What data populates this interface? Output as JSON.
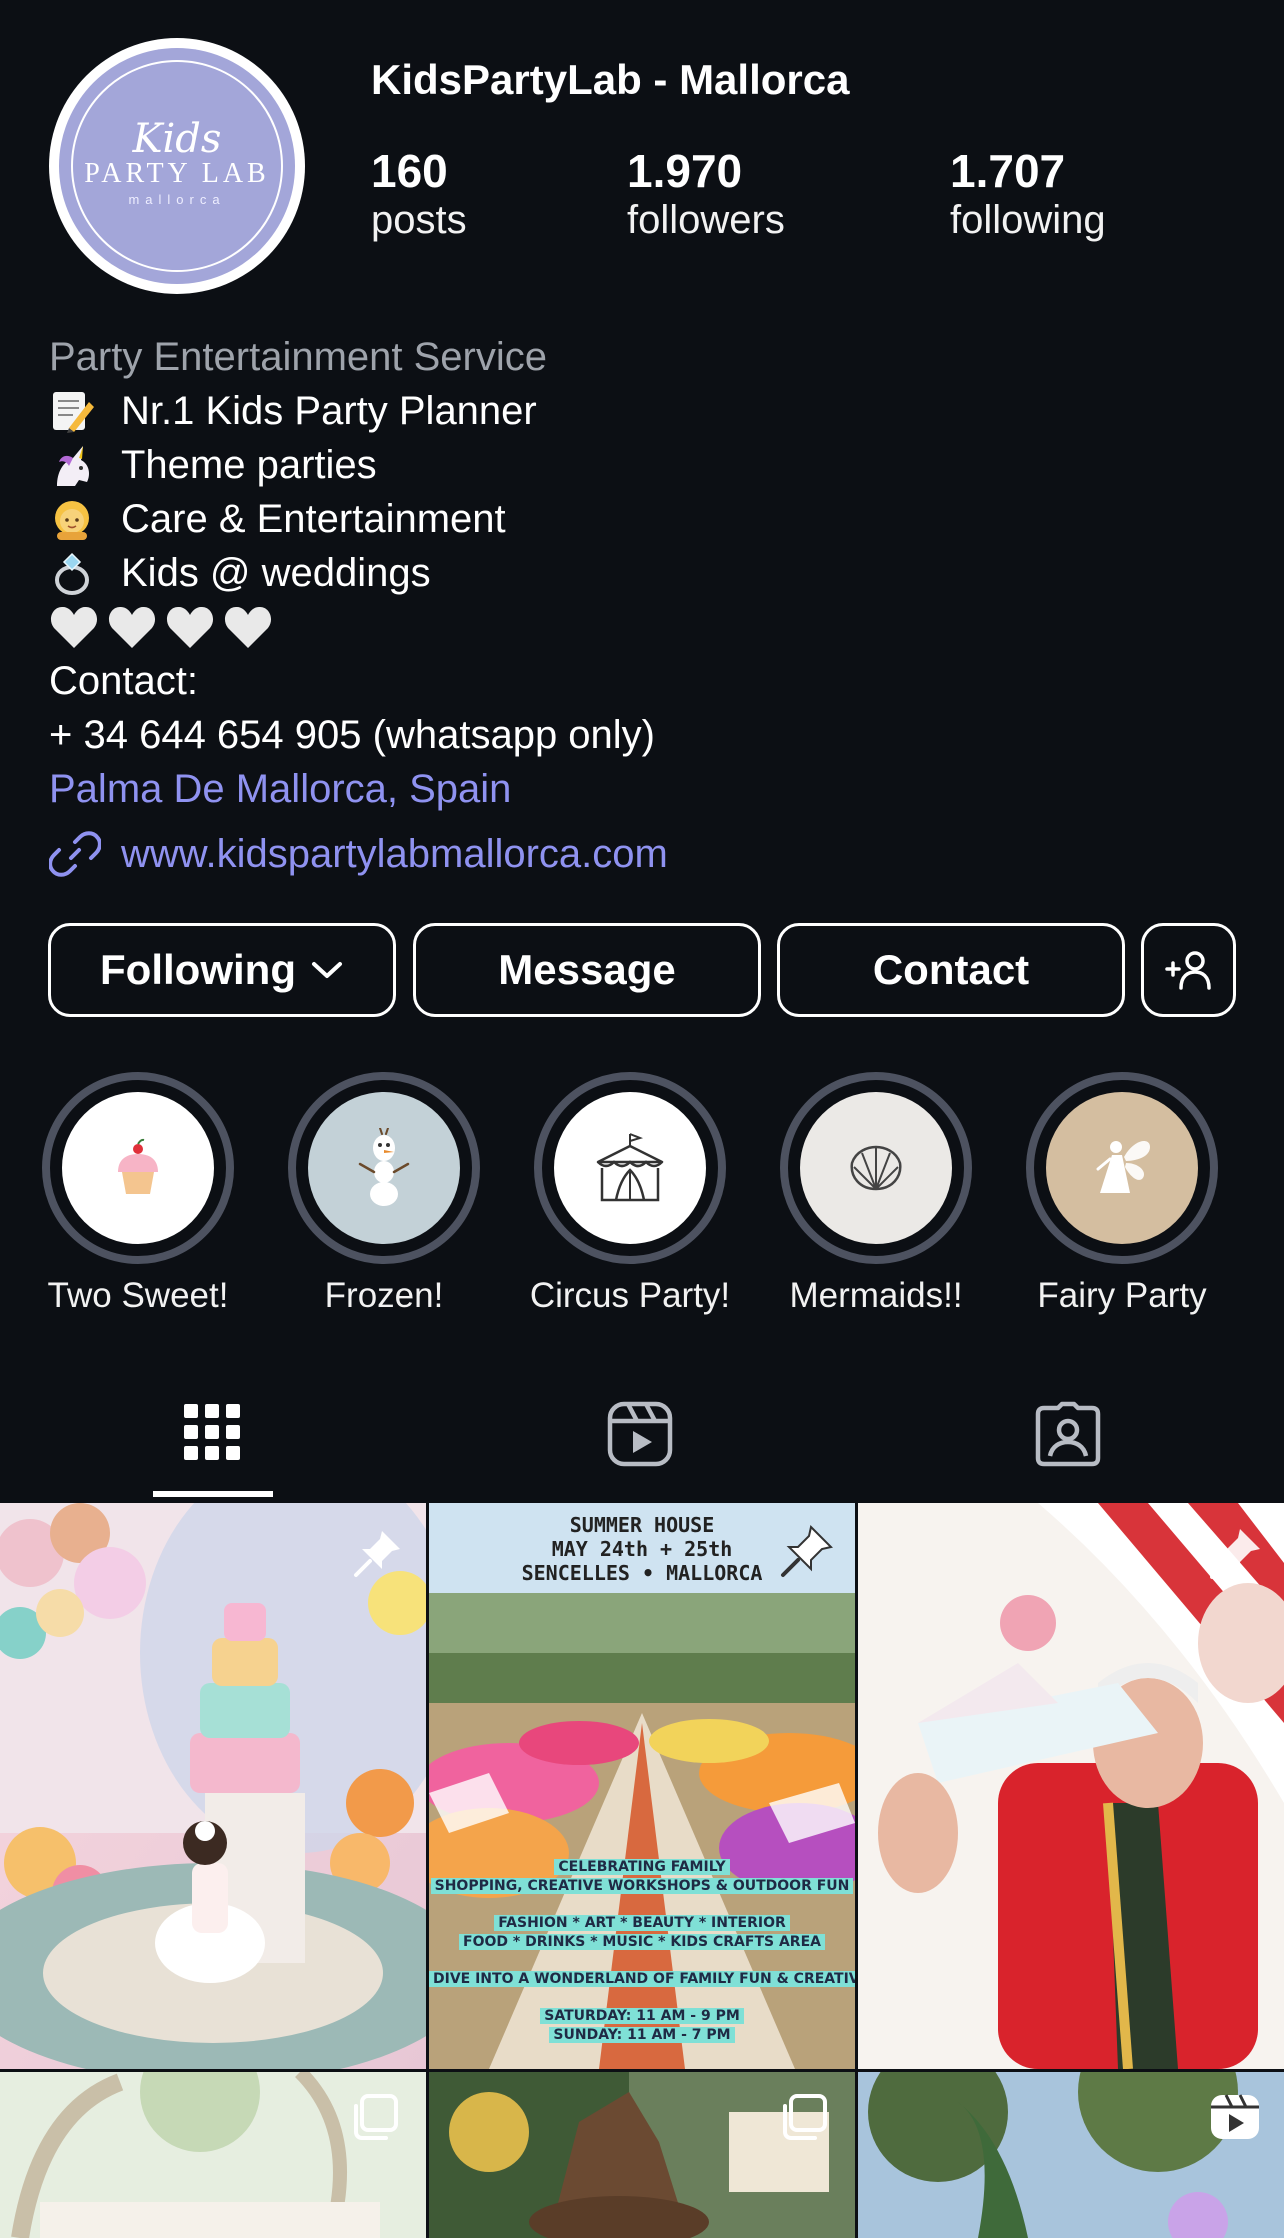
{
  "profile": {
    "username": "KidsPartyLab - Mallorca",
    "avatar": {
      "script": "Kids",
      "main": "PARTY LAB",
      "sub": "mallorca"
    },
    "stats": [
      {
        "value": "160",
        "label": "posts"
      },
      {
        "value": "1.970",
        "label": "followers"
      },
      {
        "value": "1.707",
        "label": "following"
      }
    ]
  },
  "bio": {
    "category": "Party Entertainment Service",
    "lines": [
      {
        "icon": "memo-emoji",
        "text": "Nr.1 Kids Party Planner"
      },
      {
        "icon": "unicorn-emoji",
        "text": "Theme parties"
      },
      {
        "icon": "girl-emoji",
        "text": "Care & Entertainment"
      },
      {
        "icon": "ring-emoji",
        "text": "Kids @ weddings"
      }
    ],
    "hearts": "🤍🤍🤍🤍",
    "contact_label": "Contact:",
    "phone": "+ 34 644 654 905 (whatsapp only)",
    "location": "Palma De Mallorca, Spain",
    "website": "www.kidspartylabmallorca.com"
  },
  "actions": {
    "following": "Following",
    "message": "Message",
    "contact": "Contact"
  },
  "highlights": [
    {
      "label": "Two Sweet!",
      "icon": "cupcake-icon",
      "bg": "#ffffff"
    },
    {
      "label": "Frozen!",
      "icon": "snowman-icon",
      "bg": "#c3d1d7"
    },
    {
      "label": "Circus Party!",
      "icon": "circus-tent-icon",
      "bg": "#ffffff"
    },
    {
      "label": "Mermaids!!",
      "icon": "shell-icon",
      "bg": "#ebe9e6"
    },
    {
      "label": "Fairy Party",
      "icon": "fairy-icon",
      "bg": "#d4bea0"
    }
  ],
  "tabs": [
    "grid-icon",
    "reels-icon",
    "tagged-icon"
  ],
  "posts": {
    "poster": {
      "title1": "SUMMER HOUSE",
      "title2": "MAY 24th + 25th",
      "title3": "SENCELLES • MALLORCA",
      "band1": "CELEBRATING FAMILY",
      "band2": "SHOPPING, CREATIVE WORKSHOPS & OUTDOOR FUN",
      "band3": "FASHION * ART * BEAUTY * INTERIOR",
      "band4": "FOOD * DRINKS * MUSIC * KIDS CRAFTS AREA",
      "band5": "DIVE INTO A WONDERLAND OF FAMILY FUN & CREATIVITY",
      "band6": "SATURDAY: 11 AM - 9 PM",
      "band7": "SUNDAY: 11 AM - 7 PM"
    }
  },
  "colors": {
    "background": "#0c0f14",
    "link": "#8f92f0",
    "avatar": "#a3a6d9",
    "muted": "#9ea3ab"
  }
}
